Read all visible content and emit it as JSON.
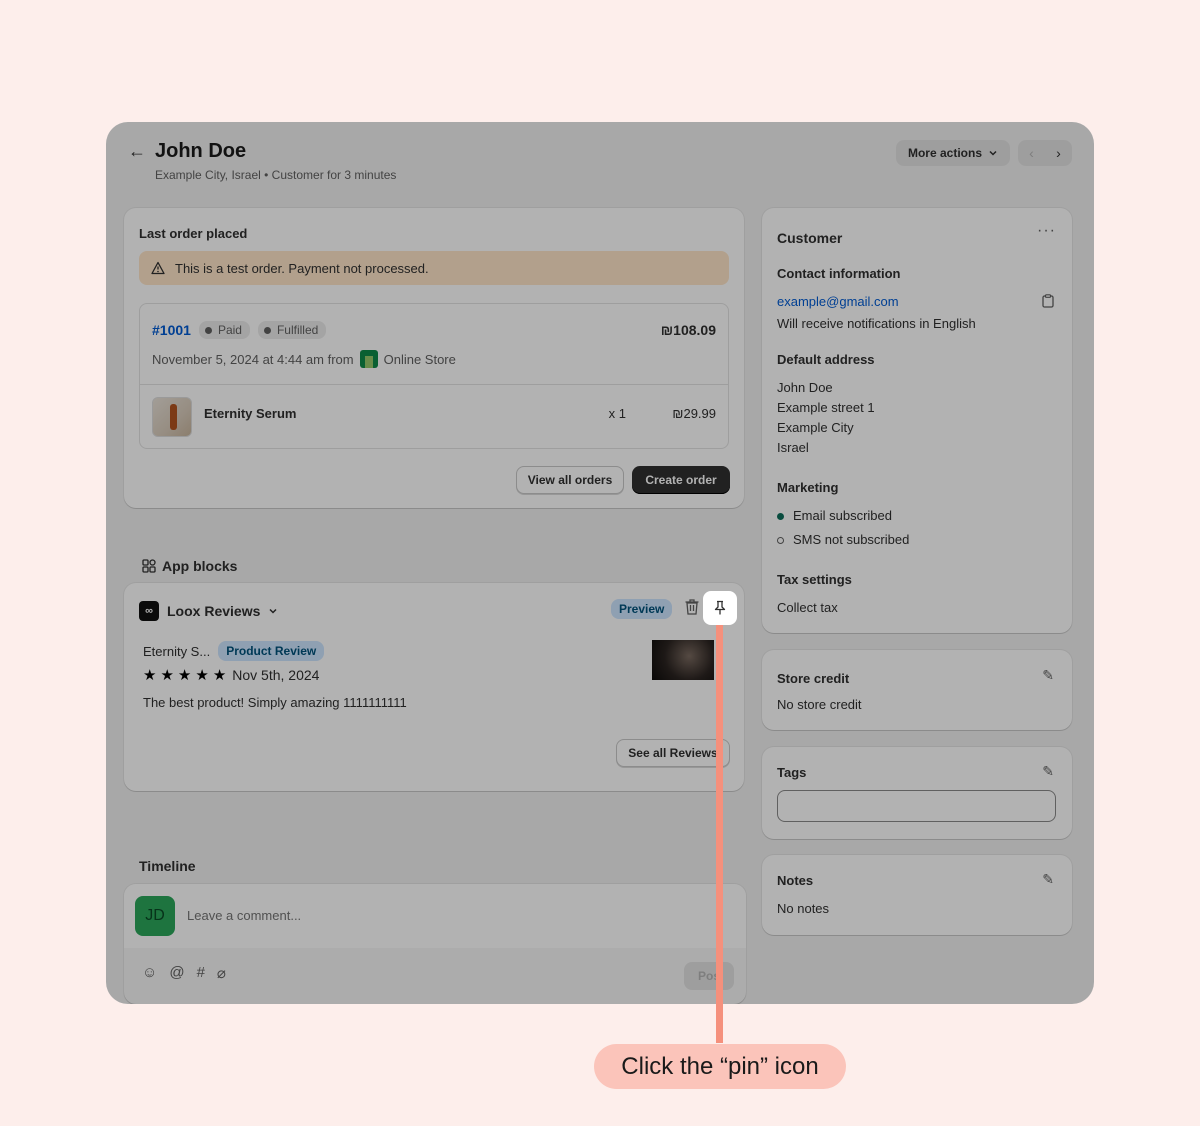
{
  "header": {
    "title": "John Doe",
    "subtitle": "Example City, Israel • Customer for 3 minutes",
    "more_actions": "More actions"
  },
  "last_order": {
    "title": "Last order placed",
    "banner": "This is a test order. Payment not processed.",
    "order_number": "#1001",
    "payment_status": "Paid",
    "fulfillment_status": "Fulfilled",
    "total": "₪108.09",
    "date_text": "November 5, 2024 at 4:44 am from",
    "channel": "Online Store",
    "product_name": "Eternity Serum",
    "quantity": "x 1",
    "price": "₪29.99",
    "view_all_label": "View all orders",
    "create_label": "Create order"
  },
  "app_blocks": {
    "label": "App blocks",
    "app_name": "Loox Reviews",
    "preview_label": "Preview",
    "review_product": "Eternity S...",
    "review_type": "Product Review",
    "stars": 5,
    "review_date": "Nov 5th, 2024",
    "review_text": "The best product! Simply amazing 1111111111",
    "see_all_label": "See all Reviews"
  },
  "timeline": {
    "label": "Timeline",
    "avatar_initials": "JD",
    "comment_placeholder": "Leave a comment...",
    "post_label": "Pos"
  },
  "customer": {
    "title": "Customer",
    "contact_title": "Contact information",
    "email": "example@gmail.com",
    "notifications": "Will receive notifications in English",
    "address_title": "Default address",
    "address_lines": [
      "John Doe",
      "Example street 1",
      "Example City",
      "Israel"
    ],
    "marketing_title": "Marketing",
    "email_marketing": "Email subscribed",
    "sms_marketing": "SMS not subscribed",
    "tax_title": "Tax settings",
    "tax_value": "Collect tax"
  },
  "store_credit": {
    "title": "Store credit",
    "value": "No store credit"
  },
  "tags": {
    "title": "Tags",
    "value": ""
  },
  "notes": {
    "title": "Notes",
    "value": "No notes"
  },
  "annotation": {
    "callout": "Click the “pin” icon"
  },
  "colors": {
    "accent": "#f5907c",
    "callout_bg": "#fbc4ba",
    "link": "#005bd3",
    "subscribed": "#0d6e5b"
  }
}
